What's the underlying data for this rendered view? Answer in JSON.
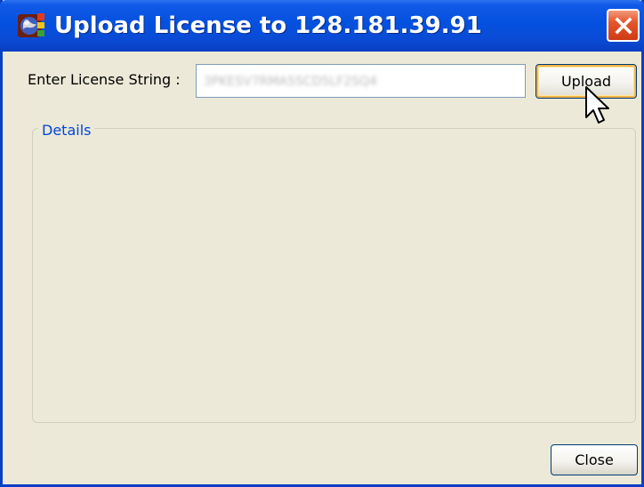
{
  "window": {
    "title": "Upload License to 128.181.39.91"
  },
  "license": {
    "label": "Enter License String :",
    "value": "3PKESV7RMA5SCD5LF2SQ4",
    "upload_label": "Upload"
  },
  "details": {
    "legend": "Details"
  },
  "footer": {
    "close_label": "Close"
  },
  "icons": {
    "app": "globe-app-icon",
    "window_close": "close-icon",
    "pointer": "mouse-pointer-icon"
  },
  "colors": {
    "titlebar": "#0451df",
    "window_bg": "#ece9d8",
    "close_button": "#e3562e",
    "legend_text": "#0046d5",
    "button_focus": "#f2b34a"
  }
}
